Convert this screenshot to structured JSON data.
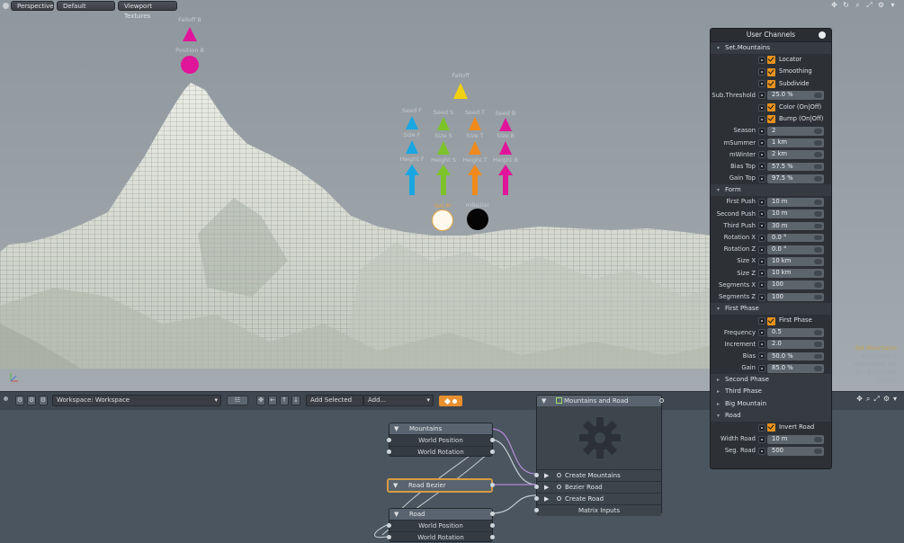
{
  "viewport": {
    "toolbar": {
      "view": "Perspective",
      "style": "Default",
      "textures": "Viewport Textures"
    },
    "gizmos": [
      {
        "label": "Falloff B",
        "shape": "triangle",
        "color": "#e0159a"
      },
      {
        "label": "Position B",
        "shape": "circle",
        "color": "#e0159a"
      },
      {
        "label": "Falloff",
        "shape": "triangle",
        "color": "#f0d010"
      },
      {
        "label": "Seed F",
        "shape": "triangle",
        "color": "#19a6e3"
      },
      {
        "label": "Size F",
        "shape": "triangle",
        "color": "#19a6e3"
      },
      {
        "label": "Height F",
        "shape": "arrow",
        "color": "#19a6e3"
      },
      {
        "label": "Seed S",
        "shape": "triangle",
        "color": "#7cc32a"
      },
      {
        "label": "Size S",
        "shape": "triangle",
        "color": "#7cc32a"
      },
      {
        "label": "Height S",
        "shape": "arrow",
        "color": "#7cc32a"
      },
      {
        "label": "Seed T",
        "shape": "triangle",
        "color": "#f08a1c"
      },
      {
        "label": "Size T",
        "shape": "triangle",
        "color": "#f08a1c"
      },
      {
        "label": "Height T",
        "shape": "arrow",
        "color": "#f08a1c"
      },
      {
        "label": "Seed B",
        "shape": "triangle",
        "color": "#e0159a"
      },
      {
        "label": "Size B",
        "shape": "triangle",
        "color": "#e0159a"
      },
      {
        "label": "Height B",
        "shape": "arrow",
        "color": "#e0159a"
      },
      {
        "label": "Set.M",
        "shape": "circle",
        "color": "#fff8ec"
      },
      {
        "label": "mBezier",
        "shape": "circle",
        "color": "#050505"
      }
    ],
    "hud": {
      "name": "Set.Mountains",
      "channels": "Channels: 0",
      "deformers": "Deformers: ON",
      "gl": "GL: 2,425,026",
      "scale": "250 m"
    }
  },
  "schematic": {
    "workspace": "Workspace: Workspace",
    "add_selected": "Add Selected",
    "add": "Add...",
    "nodes": {
      "mountains": {
        "title": "Mountains",
        "rows": [
          "World Position",
          "World Rotation"
        ]
      },
      "road_bezier": {
        "title": "Road Bezier"
      },
      "road": {
        "title": "Road",
        "rows": [
          "World Position",
          "World Rotation"
        ]
      },
      "assembly": {
        "title": "Mountains and Road (Assembly)",
        "rows": [
          "Create Mountains",
          "Bezier Road",
          "Create Road"
        ],
        "footer": "Matrix Inputs"
      }
    }
  },
  "user_channels": {
    "title": "User Channels",
    "sections": [
      {
        "name": "Set.Mountains",
        "rows": [
          {
            "type": "check",
            "label": "Locator"
          },
          {
            "type": "check",
            "label": "Smoothing"
          },
          {
            "type": "check",
            "label": "Subdivide"
          },
          {
            "type": "value",
            "label": "Sub.Threshold",
            "value": "25.0 %"
          },
          {
            "type": "check",
            "label": "Color (On|Off)"
          },
          {
            "type": "check",
            "label": "Bump (On|Off)"
          },
          {
            "type": "value",
            "label": "Season",
            "value": "2"
          },
          {
            "type": "value",
            "label": "mSummer",
            "value": "1 km"
          },
          {
            "type": "value",
            "label": "mWinter",
            "value": "2 km"
          },
          {
            "type": "value",
            "label": "Bias Top",
            "value": "57.5 %"
          },
          {
            "type": "value",
            "label": "Gain Top",
            "value": "97.5 %"
          }
        ]
      },
      {
        "name": "Form",
        "rows": [
          {
            "type": "value",
            "label": "First Push",
            "value": "10 m"
          },
          {
            "type": "value",
            "label": "Second Push",
            "value": "10 m"
          },
          {
            "type": "value",
            "label": "Third Push",
            "value": "30 m"
          },
          {
            "type": "value",
            "label": "Rotation X",
            "value": "0.0 °"
          },
          {
            "type": "value",
            "label": "Rotation Z",
            "value": "0.0 °"
          },
          {
            "type": "value",
            "label": "Size X",
            "value": "10 km"
          },
          {
            "type": "value",
            "label": "Size Z",
            "value": "10 km"
          },
          {
            "type": "value",
            "label": "Segments X",
            "value": "100"
          },
          {
            "type": "value",
            "label": "Segments Z",
            "value": "100"
          }
        ]
      },
      {
        "name": "First Phase",
        "rows": [
          {
            "type": "check",
            "label": "First Phase"
          },
          {
            "type": "value",
            "label": "Frequency",
            "value": "0.5"
          },
          {
            "type": "value",
            "label": "Increment",
            "value": "2.0"
          },
          {
            "type": "value",
            "label": "Bias",
            "value": "50.0 %"
          },
          {
            "type": "value",
            "label": "Gain",
            "value": "85.0 %"
          }
        ]
      },
      {
        "name": "Second Phase",
        "closed": true,
        "rows": []
      },
      {
        "name": "Third Phase",
        "closed": true,
        "rows": []
      },
      {
        "name": "Big Mountain",
        "closed": true,
        "rows": []
      },
      {
        "name": "Road",
        "rows": [
          {
            "type": "check",
            "label": "Invert Road"
          },
          {
            "type": "value",
            "label": "Width Road",
            "value": "10 m"
          },
          {
            "type": "value",
            "label": "Seg. Road",
            "value": "500"
          }
        ]
      }
    ]
  }
}
